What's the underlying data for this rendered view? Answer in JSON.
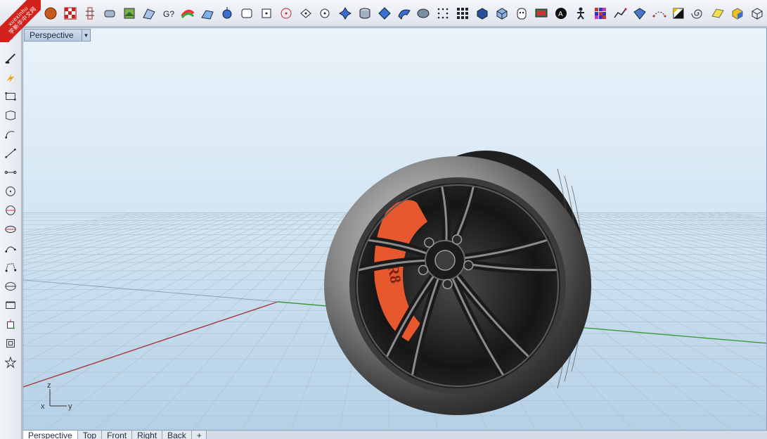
{
  "watermark": {
    "latin": "xuexinhu",
    "cjk": "学新华中文网"
  },
  "toolbar_top": [
    {
      "name": "sphere-render-icon"
    },
    {
      "name": "checker-map-icon"
    },
    {
      "name": "analyze-points-icon"
    },
    {
      "name": "capsule-icon"
    },
    {
      "name": "texture-map-icon"
    },
    {
      "name": "draft-angle-icon"
    },
    {
      "name": "help-icon"
    },
    {
      "name": "zebra-icon"
    },
    {
      "name": "curvature-icon"
    },
    {
      "name": "point-on-surface-icon"
    },
    {
      "name": "rounded-rectangle-icon"
    },
    {
      "name": "square-icon"
    },
    {
      "name": "circle-target-icon"
    },
    {
      "name": "snap-point-icon"
    },
    {
      "name": "circle-point-icon"
    },
    {
      "name": "move-handle-icon"
    },
    {
      "name": "cylinder-icon"
    },
    {
      "name": "diamond-icon"
    },
    {
      "name": "bend-surface-icon"
    },
    {
      "name": "lasso-shape-icon"
    },
    {
      "name": "point-cloud-icon"
    },
    {
      "name": "grid-points-icon"
    },
    {
      "name": "solid-box-icon"
    },
    {
      "name": "cube-icon"
    },
    {
      "name": "mask-icon"
    },
    {
      "name": "monitor-icon"
    },
    {
      "name": "annotation-icon"
    },
    {
      "name": "human-figure-icon"
    },
    {
      "name": "color-grid-icon"
    },
    {
      "name": "polyline-icon"
    },
    {
      "name": "mesh-surface-icon"
    },
    {
      "name": "select-curve-icon"
    },
    {
      "name": "split-square-icon"
    },
    {
      "name": "spiral-icon"
    },
    {
      "name": "plane-surface-icon"
    },
    {
      "name": "box-surface-icon"
    },
    {
      "name": "cube-outline-icon"
    }
  ],
  "toolbar_left": [
    {
      "name": "move-arrow-icon"
    },
    {
      "name": "line-icon"
    },
    {
      "name": "lightning-icon"
    },
    {
      "name": "rectangle-icon"
    },
    {
      "name": "polygon-points-icon"
    },
    {
      "name": "arc-icon"
    },
    {
      "name": "polyline-left-icon"
    },
    {
      "name": "point-line-icon"
    },
    {
      "name": "circle-icon"
    },
    {
      "name": "circle-center-icon"
    },
    {
      "name": "ellipse-icon"
    },
    {
      "name": "curve-points-icon"
    },
    {
      "name": "control-points-icon"
    },
    {
      "name": "sphere-left-icon"
    },
    {
      "name": "box-left-icon"
    },
    {
      "name": "extrude-icon"
    },
    {
      "name": "frame-icon"
    },
    {
      "name": "star-icon"
    }
  ],
  "viewport": {
    "title": "Perspective",
    "dropdown_glyph": "▼",
    "axes": {
      "z": "z",
      "x": "x",
      "y": "y"
    },
    "logo_text": "R8"
  },
  "tabs": [
    {
      "label": "Perspective",
      "active": true
    },
    {
      "label": "Top",
      "active": false
    },
    {
      "label": "Front",
      "active": false
    },
    {
      "label": "Right",
      "active": false
    },
    {
      "label": "Back",
      "active": false
    },
    {
      "label": "+",
      "active": false
    }
  ],
  "colors": {
    "sky_top": "#e6f0f8",
    "sky_bottom": "#b9d3e8",
    "grid_line": "#9fb3c4",
    "x_axis": "#a33a3a",
    "y_axis": "#3a9a3a",
    "caliper": "#e8582e"
  }
}
